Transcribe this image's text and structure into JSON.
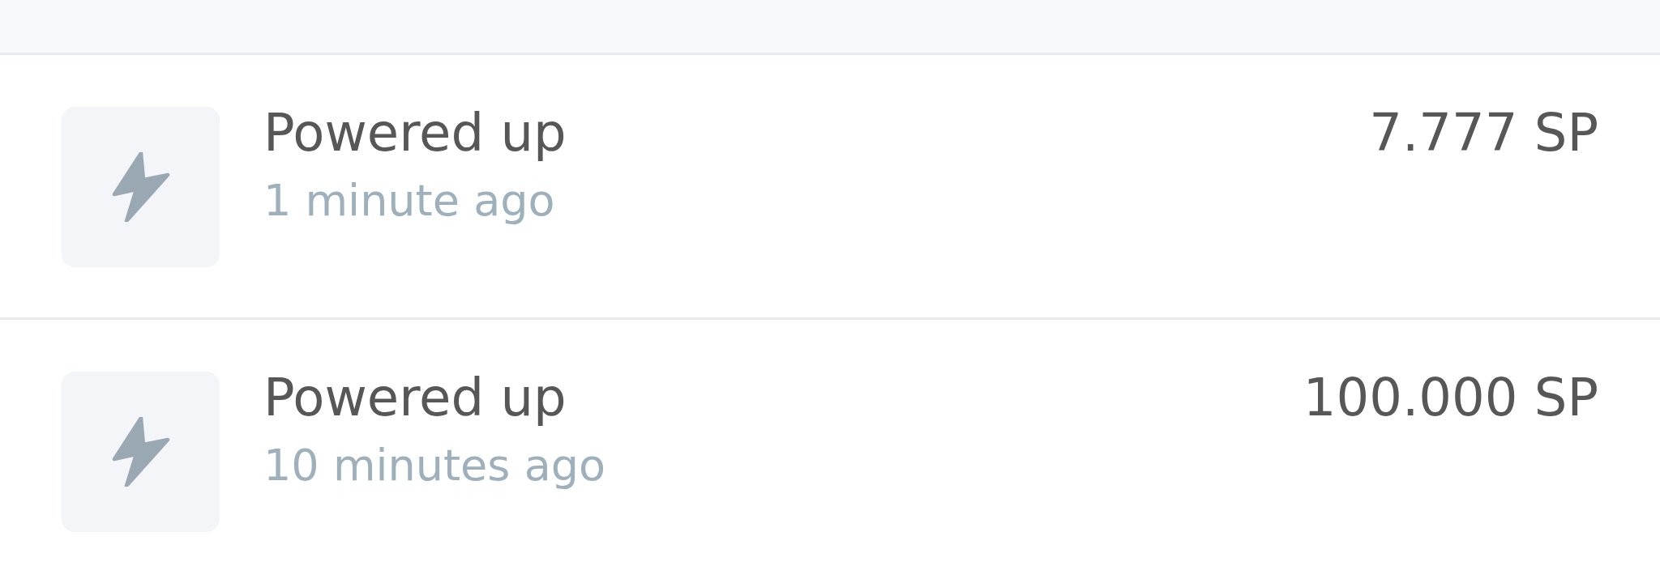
{
  "transactions": [
    {
      "kind": "power_up",
      "title": "Powered up",
      "time": "1 minute ago",
      "amount": "7.777 SP"
    },
    {
      "kind": "power_up",
      "title": "Powered up",
      "time": "10 minutes ago",
      "amount": "100.000 SP"
    }
  ]
}
